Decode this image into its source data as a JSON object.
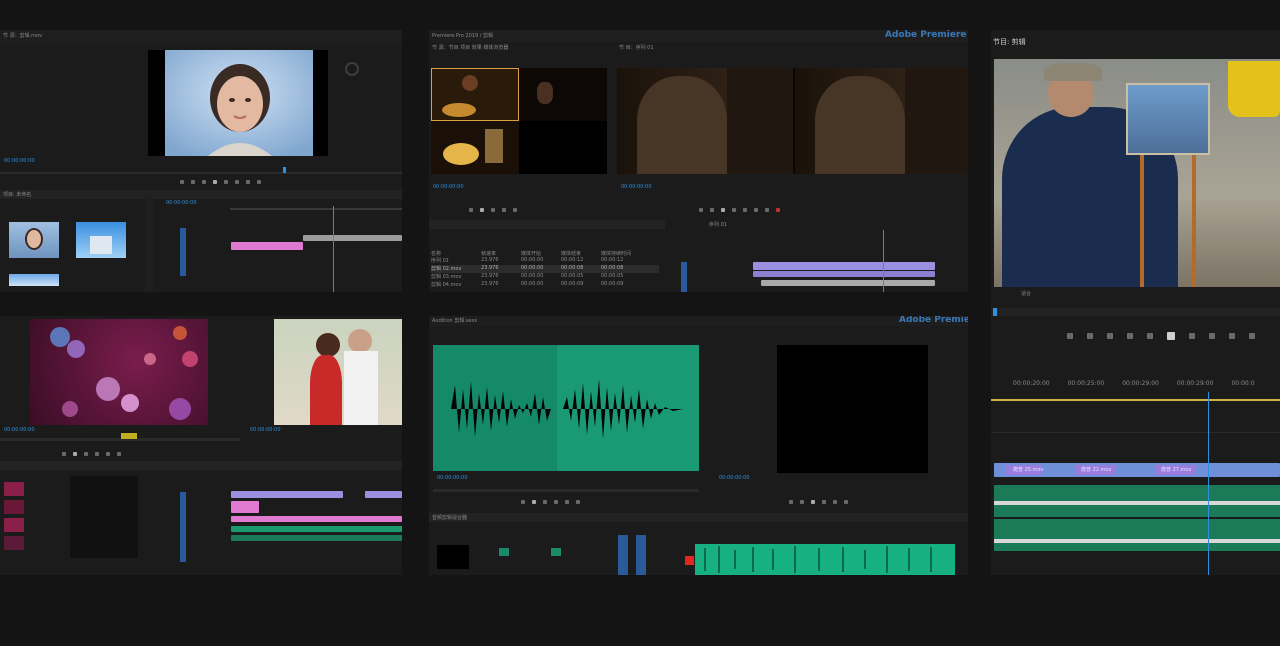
{
  "tl": {
    "panel_title": "节 源：剪辑.mov",
    "program_tc": "00:00:00:00",
    "bin_tab": "项目: 未命名",
    "seq_tc": "00:00:00:00"
  },
  "tc": {
    "header": "Premiere Pro 2019 / 剪辑",
    "brand": "Adobe Premiere",
    "tab_project": "节 源：节目 项目 效果 媒体浏览器",
    "tab_program": "节 目：序列 01",
    "src_tc": "00:00:00:00",
    "prog_tc": "00:00:00:00",
    "list_head": [
      "名称",
      "帧速率",
      "媒体开始",
      "媒体结束",
      "媒体持续时间"
    ],
    "list_rows": [
      [
        "序列 01",
        "23.976",
        "00:00:00",
        "00:00:12",
        "00:00:12"
      ],
      [
        "剪辑 02.mov",
        "23.976",
        "00:00:00",
        "00:00:08",
        "00:00:08"
      ],
      [
        "剪辑 03.mov",
        "23.976",
        "00:00:00",
        "00:00:05",
        "00:00:05"
      ],
      [
        "剪辑 04.mov",
        "23.976",
        "00:00:00",
        "00:00:09",
        "00:00:09"
      ]
    ],
    "seq_tab": "序列 01"
  },
  "tr": {
    "panel_title": "节目: 剪辑",
    "menu_label": "适合",
    "timecodes": [
      "00:00:20:00",
      "00:00:25:00",
      "00:00:29:00",
      "00:00:29:00",
      "00:00:0"
    ],
    "clips": [
      "爬普 25.mov",
      "爬普 22.mov",
      "爬普 27.mov"
    ]
  },
  "bl": {
    "tc1": "00:00:00:00",
    "tc2": "00:00:00:00"
  },
  "bc": {
    "header": "Audition 剪辑.sesx",
    "brand": "Adobe Premiere",
    "tc_left": "00:00:00:00",
    "tc_right": "00:00:00:00",
    "mixer_tab": "音频剪辑混合器"
  },
  "icons": {
    "play": "play-icon",
    "step_back": "step-back-icon",
    "step_forward": "step-forward-icon",
    "insert": "insert-icon",
    "overwrite": "overwrite-icon",
    "export": "export-frame-icon",
    "marker": "marker-icon"
  },
  "colors": {
    "accent": "#2e8fe0",
    "audio_green": "#14856a",
    "clip_violet": "#9b8fe0",
    "clip_pink": "#e07ad0"
  }
}
